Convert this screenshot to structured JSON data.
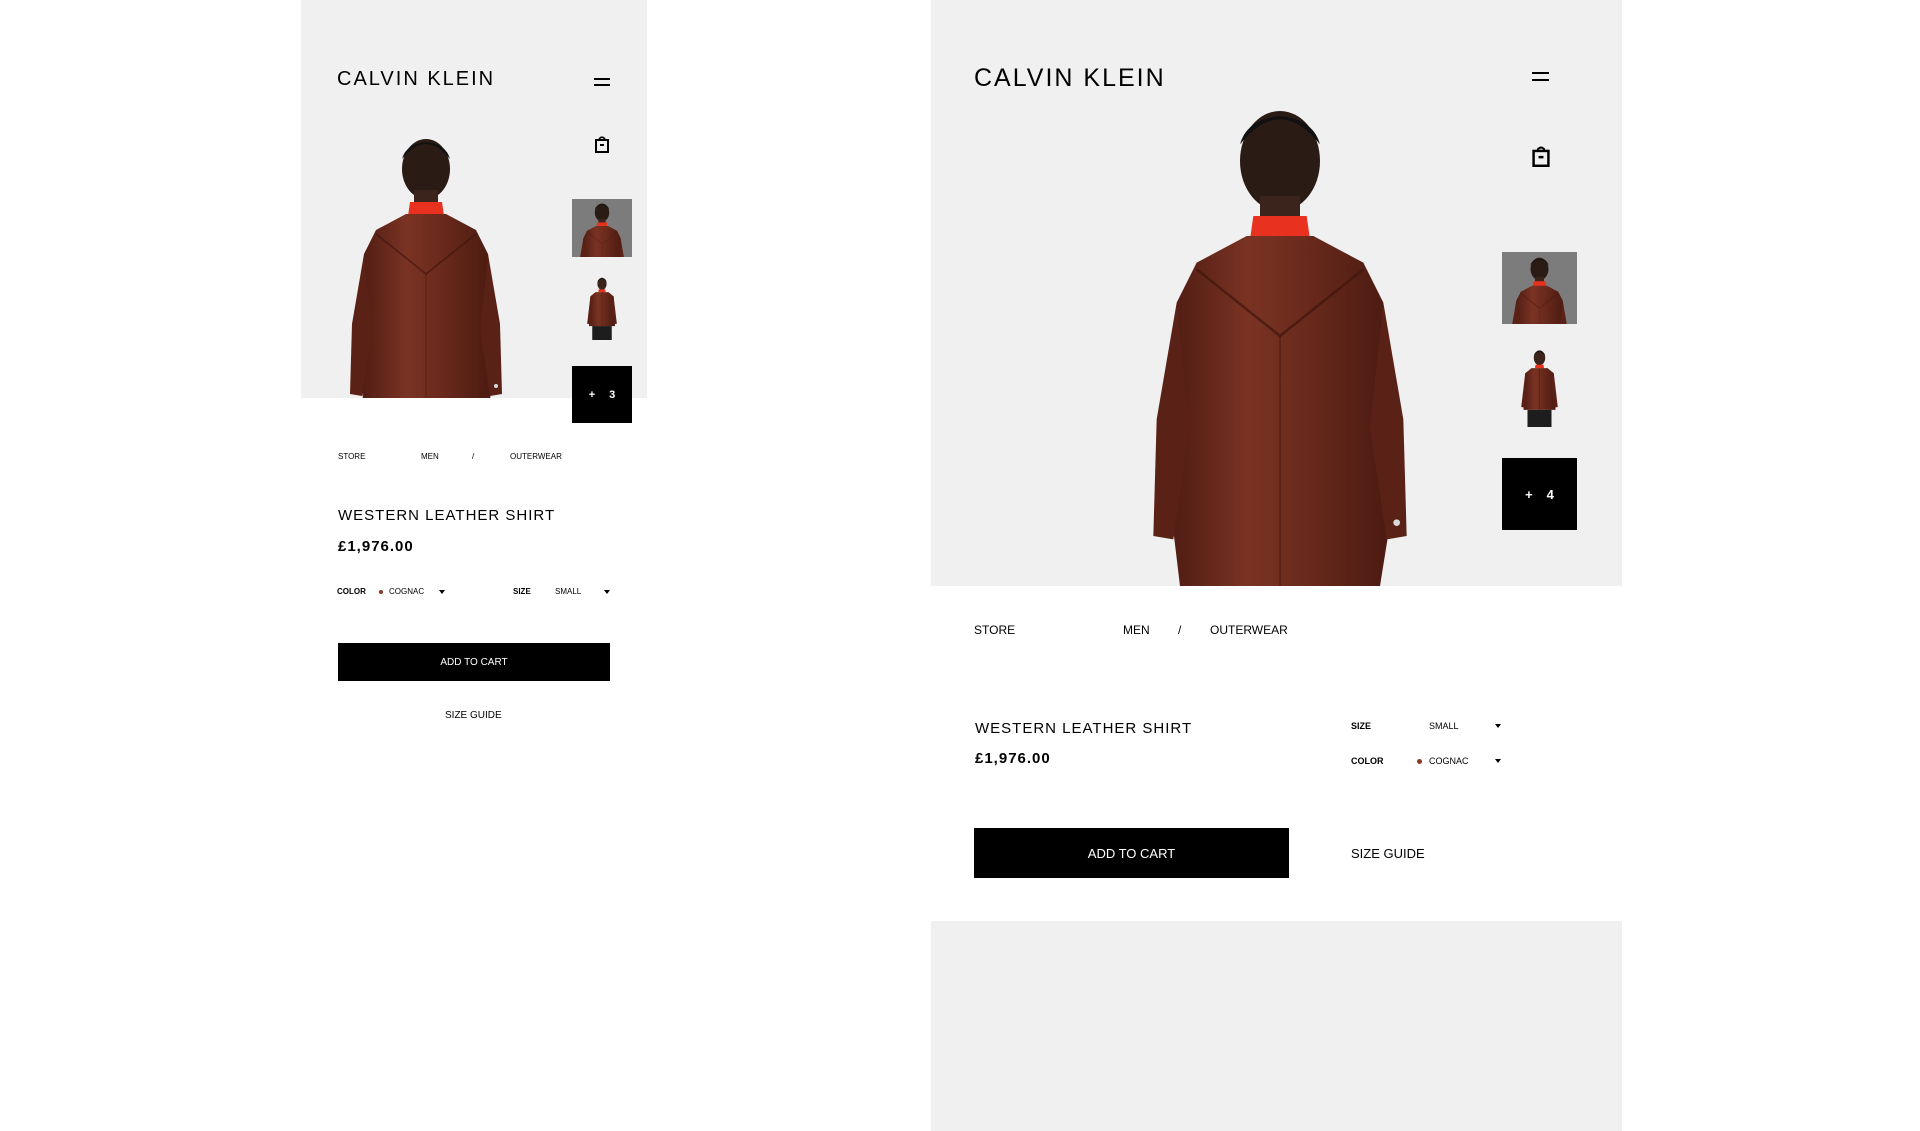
{
  "brand": {
    "logo_text": "CALVIN KLEIN"
  },
  "mobile": {
    "more_count": "3",
    "breadcrumb": {
      "store": "STORE",
      "men": "MEN",
      "separator": "/",
      "category": "OUTERWEAR"
    },
    "product": {
      "title": "WESTERN LEATHER SHIRT",
      "price": "£1,976.00"
    },
    "options": {
      "color_label": "COLOR",
      "color_value": "COGNAC",
      "size_label": "SIZE",
      "size_value": "SMALL"
    },
    "add_to_cart_label": "ADD TO CART",
    "size_guide_label": "SIZE GUIDE"
  },
  "desktop": {
    "more_count": "4",
    "breadcrumb": {
      "store": "STORE",
      "men": "MEN",
      "separator": "/",
      "category": "OUTERWEAR"
    },
    "product": {
      "title": "WESTERN LEATHER SHIRT",
      "price": "£1,976.00"
    },
    "options": {
      "size_label": "SIZE",
      "size_value": "SMALL",
      "color_label": "COLOR",
      "color_value": "COGNAC"
    },
    "add_to_cart_label": "ADD TO CART",
    "size_guide_label": "SIZE GUIDE"
  },
  "icons": {
    "menu": "hamburger-menu-icon",
    "bag": "shopping-bag-icon",
    "more": "plus-icon"
  },
  "colors": {
    "panel_gray": "#f0f0f0",
    "button_black": "#000000",
    "leather": "#6e2a1d",
    "collar_red": "#e8321f",
    "swatch_cognac": "#8a3a26"
  }
}
